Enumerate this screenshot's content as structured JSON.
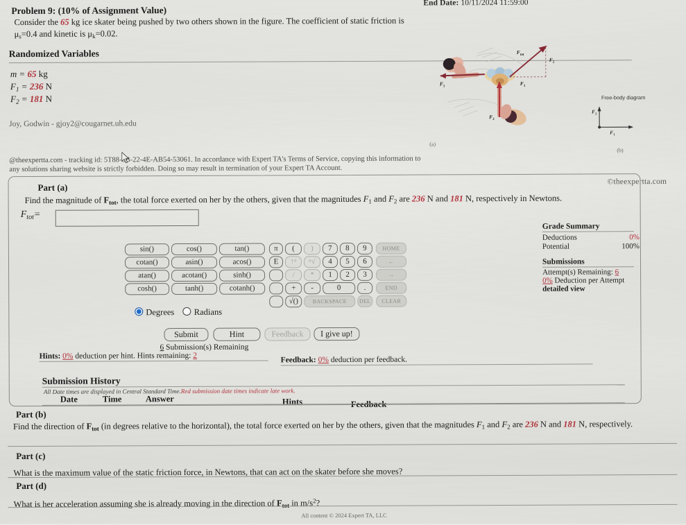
{
  "header": {
    "end_date_label": "End Date:",
    "end_date_value": "10/11/2024 11:59:00"
  },
  "problem": {
    "title": "Problem 9: (10% of Assignment Value)",
    "body_a": "Consider the ",
    "mass_inline": "65",
    "body_b": " kg ice skater being pushed by two others shown in the figure. The coefficient of static friction is μ",
    "mu_s_sub": "s",
    "mu_s_val": "=0.4 and kinetic is μ",
    "mu_k_sub": "k",
    "mu_k_val": "=0.02."
  },
  "randomized": {
    "heading": "Randomized Variables",
    "rows": [
      {
        "sym": "m",
        "sub": "",
        "eq": " = ",
        "val": "65",
        "unit": "kg"
      },
      {
        "sym": "F",
        "sub": "1",
        "eq": " = ",
        "val": "236",
        "unit": "N"
      },
      {
        "sym": "F",
        "sub": "2",
        "eq": " = ",
        "val": "181",
        "unit": "N"
      }
    ]
  },
  "student_line": "Joy, Godwin - gjoy2@cougarnet.uh.edu",
  "tracking": {
    "line1": "@theexpertta.com - tracking id: 5T88-8B-22-4E-AB54-53061. In accordance with Expert TA's Terms of Service, copying this",
    "line2": "information to any solutions sharing website is strictly forbidden. Doing so may result in termination of your Expert TA Account."
  },
  "watermark": "©theexpertta.com",
  "figure": {
    "caption_a": "(a)",
    "caption_b": "(b)",
    "fbd_title": "Free-body diagram",
    "labels": {
      "f_tot": "F",
      "f_tot_sub": "tot",
      "f1": "F",
      "f1_sub": "1",
      "f2": "F",
      "f2_sub": "2"
    }
  },
  "part_a": {
    "label": "Part (a)",
    "prompt_1": "Find the magnitude of ",
    "prompt_sym": "F",
    "prompt_sub": "tot",
    "prompt_2": ", the total force exerted on her by the others, given that the magnitudes ",
    "prompt_F1": "F",
    "prompt_F1_sub": "1",
    "prompt_and": " and ",
    "prompt_F2": "F",
    "prompt_F2_sub": "2",
    "prompt_3": " are ",
    "val_F1": "236",
    "mid": " N and ",
    "val_F2": "181",
    "prompt_4": " N, respectively in Newtons.",
    "answer_symbol": "F",
    "answer_sub": "tot",
    "answer_eq": "=",
    "answer_value": "",
    "answer_placeholder": ""
  },
  "keypad": {
    "functions": [
      "sin()",
      "cos()",
      "tan()",
      "cotan()",
      "asin()",
      "acos()",
      "atan()",
      "acotan()",
      "sinh()",
      "cosh()",
      "tanh()",
      "cotanh()"
    ],
    "mode": {
      "degrees": "Degrees",
      "radians": "Radians",
      "selected": "Degrees"
    },
    "col_special": [
      "π",
      "E",
      "",
      ""
    ],
    "keys_row1": [
      "(",
      ")",
      "7",
      "8",
      "9"
    ],
    "keys_row2": [
      "↑ⁿ",
      "ⁿ√",
      "4",
      "5",
      "6"
    ],
    "keys_row3": [
      "/",
      "*",
      "1",
      "2",
      "3"
    ],
    "keys_row4": [
      "+",
      "-",
      "0",
      "."
    ],
    "keys_row5": [
      "√()",
      "BACKSPACE",
      "DEL"
    ],
    "nav": [
      "HOME",
      "←",
      "→",
      "END",
      "CLEAR"
    ]
  },
  "actions": {
    "submit": "Submit",
    "hint": "Hint",
    "feedback": "Feedback",
    "give_up": "I give up!"
  },
  "status": {
    "submissions_remaining_count": "6",
    "submissions_remaining_text": "Submission(s) Remaining",
    "hints_label": "Hints:",
    "hints_pct": "0%",
    "hints_text": "deduction per hint. Hints remaining:",
    "hints_remaining_count": "2",
    "feedback_label": "Feedback:",
    "feedback_pct": "0%",
    "feedback_text": "deduction per feedback."
  },
  "grade_summary": {
    "title": "Grade Summary",
    "rows": [
      {
        "key": "Deductions",
        "value": "0%",
        "red": true
      },
      {
        "key": "Potential",
        "value": "100%",
        "red": false
      }
    ],
    "submissions_title": "Submissions",
    "attempts_label": "Attempt(s) Remaining:",
    "attempts_value": "6",
    "deduction_pct": "0%",
    "deduction_text": "Deduction per Attempt",
    "detailed_view": "detailed view"
  },
  "submission_history": {
    "title": "Submission History",
    "note_1": "All Date times are displayed in Central Standard Time.",
    "note_2": "Red submission date times indicate late work.",
    "columns": [
      "Date",
      "Time",
      "Answer",
      "Hints",
      "Feedback"
    ]
  },
  "part_b": {
    "label": "Part (b)",
    "t1": "Find the direction of ",
    "sym": "F",
    "sub": "tot",
    "t2": " (in degrees relative to the horizontal), the total force exerted on her by the others, given that the magnitudes ",
    "F1": "F",
    "F1s": "1",
    "and": " and ",
    "F2": "F",
    "F2s": "2",
    "t3": " are ",
    "v1": "236",
    "t4": " N and ",
    "v2": "181",
    "t5": " N, respectively."
  },
  "part_c": {
    "label": "Part (c)",
    "text": "What is the maximum value of the static friction force, in Newtons, that can act on the skater before she moves?"
  },
  "part_d": {
    "label": "Part (d)",
    "t1": "What is her acceleration assuming she is already moving in the direction of ",
    "sym": "F",
    "sub": "tot",
    "t2": " in m/s",
    "exp": "2",
    "t3": "?"
  },
  "footer": "All content © 2024 Expert TA, LLC",
  "colors": {
    "accent_red": "#b5333c",
    "radio_blue": "#1f6fd0",
    "paper": "#e8e8e4"
  }
}
